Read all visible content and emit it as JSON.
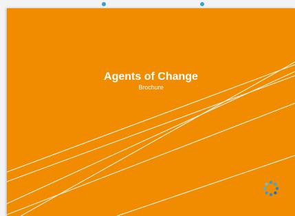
{
  "slide": {
    "title": "Agents of Change",
    "subtitle": "Brochure"
  },
  "colors": {
    "background": "#f18b00",
    "text": "#ffffff",
    "lines": "#ffffff",
    "selection_handle": "#3aa0d8"
  },
  "icons": {
    "logo": "circular-dots-logo-icon",
    "handles": "selection-handle-icon"
  }
}
